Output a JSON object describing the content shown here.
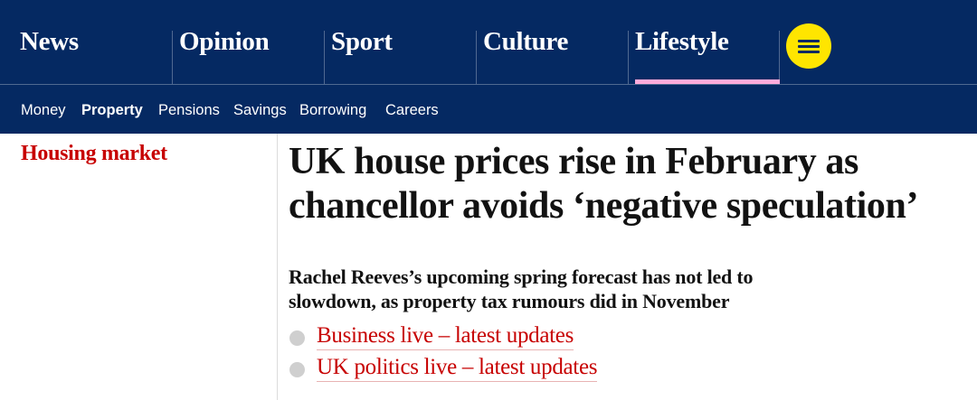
{
  "pillars": [
    {
      "label": "News",
      "active": false
    },
    {
      "label": "Opinion",
      "active": false
    },
    {
      "label": "Sport",
      "active": false
    },
    {
      "label": "Culture",
      "active": false
    },
    {
      "label": "Lifestyle",
      "active": true
    }
  ],
  "menu_icon": "hamburger-menu-icon",
  "subnav": {
    "items": [
      {
        "label": "Money",
        "active": false
      },
      {
        "label": "Property",
        "active": true
      },
      {
        "label": "Pensions",
        "active": false
      },
      {
        "label": "Savings",
        "active": false
      },
      {
        "label": "Borrowing",
        "active": false
      },
      {
        "label": "Careers",
        "active": false
      }
    ]
  },
  "article": {
    "section": "Housing market",
    "headline_lines": [
      "UK house prices rise in February as",
      "chancellor avoids ‘negative speculation’"
    ],
    "standfirst_lines": [
      "Rachel Reeves’s upcoming spring forecast has not led to",
      "slowdown, as property tax rumours did in November"
    ],
    "related_links": [
      "Business live – latest updates",
      "UK politics live – latest updates"
    ]
  },
  "colors": {
    "nav_background": "#052962",
    "active_underline": "#ffabdb",
    "menu_button": "#ffe500",
    "section_red": "#c70000",
    "text": "#121212"
  }
}
